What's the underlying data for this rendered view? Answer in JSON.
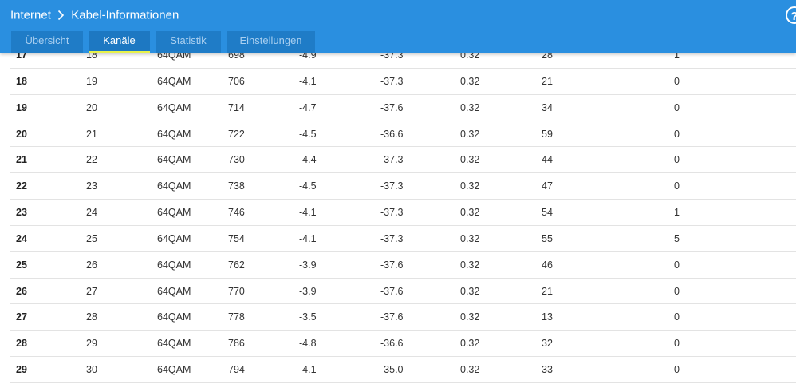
{
  "header": {
    "breadcrumb_root": "Internet",
    "breadcrumb_page": "Kabel-Informationen",
    "help_label": "?"
  },
  "tabs": [
    {
      "label": "Übersicht",
      "active": false
    },
    {
      "label": "Kanäle",
      "active": true
    },
    {
      "label": "Statistik",
      "active": false
    },
    {
      "label": "Einstellungen",
      "active": false
    }
  ],
  "colors": {
    "header_bg": "#2a8fe0",
    "tab_bg": "#1f7cc7",
    "active_underline": "#e8f24a"
  },
  "table": {
    "rows": [
      [
        "17",
        "18",
        "64QAM",
        "698",
        "-4.9",
        "-37.3",
        "0.32",
        "28",
        "1"
      ],
      [
        "18",
        "19",
        "64QAM",
        "706",
        "-4.1",
        "-37.3",
        "0.32",
        "21",
        "0"
      ],
      [
        "19",
        "20",
        "64QAM",
        "714",
        "-4.7",
        "-37.6",
        "0.32",
        "34",
        "0"
      ],
      [
        "20",
        "21",
        "64QAM",
        "722",
        "-4.5",
        "-36.6",
        "0.32",
        "59",
        "0"
      ],
      [
        "21",
        "22",
        "64QAM",
        "730",
        "-4.4",
        "-37.3",
        "0.32",
        "44",
        "0"
      ],
      [
        "22",
        "23",
        "64QAM",
        "738",
        "-4.5",
        "-37.3",
        "0.32",
        "47",
        "0"
      ],
      [
        "23",
        "24",
        "64QAM",
        "746",
        "-4.1",
        "-37.3",
        "0.32",
        "54",
        "1"
      ],
      [
        "24",
        "25",
        "64QAM",
        "754",
        "-4.1",
        "-37.3",
        "0.32",
        "55",
        "5"
      ],
      [
        "25",
        "26",
        "64QAM",
        "762",
        "-3.9",
        "-37.6",
        "0.32",
        "46",
        "0"
      ],
      [
        "26",
        "27",
        "64QAM",
        "770",
        "-3.9",
        "-37.6",
        "0.32",
        "21",
        "0"
      ],
      [
        "27",
        "28",
        "64QAM",
        "778",
        "-3.5",
        "-37.6",
        "0.32",
        "13",
        "0"
      ],
      [
        "28",
        "29",
        "64QAM",
        "786",
        "-4.8",
        "-36.6",
        "0.32",
        "32",
        "0"
      ],
      [
        "29",
        "30",
        "64QAM",
        "794",
        "-4.1",
        "-35.0",
        "0.32",
        "33",
        "0"
      ]
    ]
  }
}
